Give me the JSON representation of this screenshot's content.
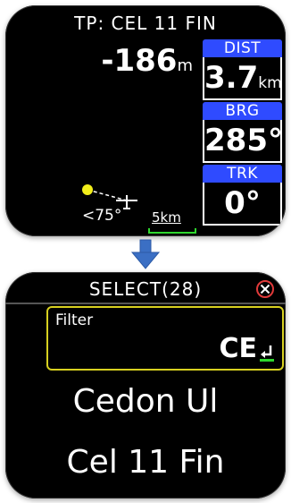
{
  "top_screen": {
    "title": "TP: CEL 11 FIN",
    "altitude": {
      "value": "-186",
      "unit": "m"
    },
    "dist": {
      "label": "DIST",
      "value": "3.7",
      "unit": "km"
    },
    "brg": {
      "label": "BRG",
      "value": "285°"
    },
    "trk": {
      "label": "TRK",
      "value": "0°"
    },
    "bearing_text": "<75°",
    "scale_text": "5km"
  },
  "bottom_screen": {
    "title": "SELECT(28)",
    "filter": {
      "label": "Filter",
      "value": "CE"
    },
    "items": [
      {
        "label": "Cedon Ul"
      },
      {
        "label": "Cel 11 Fin"
      }
    ]
  },
  "colors": {
    "header_blue": "#2f4bff",
    "filter_border": "#d7d020",
    "scale_green": "#2ed62e",
    "arrow_blue": "#3b6fc4",
    "close_red": "#e03a3a"
  },
  "icons": [
    "glider-icon",
    "waypoint-dot-icon",
    "down-arrow-icon",
    "close-icon",
    "enter-icon"
  ]
}
